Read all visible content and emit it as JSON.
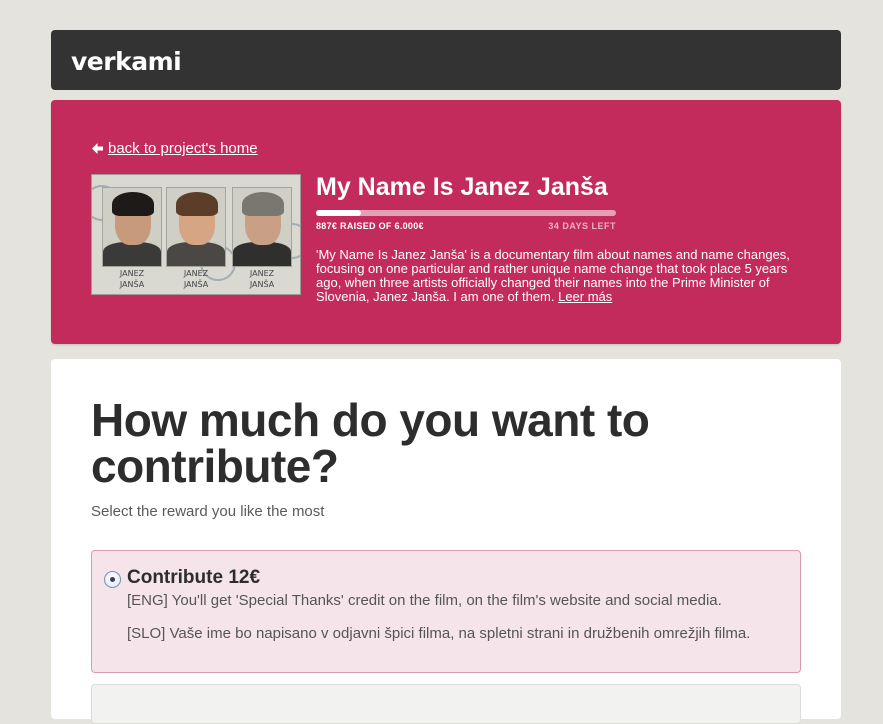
{
  "header": {
    "logo_text": "verkami"
  },
  "project": {
    "back_link": "back to project's home",
    "title": "My Name Is Janez Janša",
    "progress_fraction": 0.15,
    "raised_text": "887€ RAISED OF 6.000€",
    "days_left_text": "34 DAYS LEFT",
    "description": "'My Name Is Janez Janša' is a documentary film about names and name changes, focusing on one particular and rather unique name change that took place 5 years ago, when three artists officially changed their names into the Prime Minister of Slovenia, Janez Janša. I am one of them.",
    "read_more": "Leer más",
    "thumbnail_names": [
      "JANEZ\nJANŠA",
      "JANEZ\nJANŠA",
      "JANEZ\nJANŠA"
    ],
    "colors": {
      "card_bg": "#c32b5c",
      "topbar_bg": "#333333"
    }
  },
  "contribute": {
    "heading": "How much do you want to contribute?",
    "subheading": "Select the reward you like the most",
    "rewards": [
      {
        "title": "Contribute 12€",
        "eng": "[ENG] You'll get 'Special Thanks' credit on the film, on the film's website and social media.",
        "slo": "[SLO] Vaše ime bo napisano v odjavni špici filma, na spletni strani in družbenih omrežjih filma.",
        "selected": true
      }
    ]
  },
  "icons": {
    "back": "arrow-left-icon",
    "radio": "radio-selected-icon"
  }
}
